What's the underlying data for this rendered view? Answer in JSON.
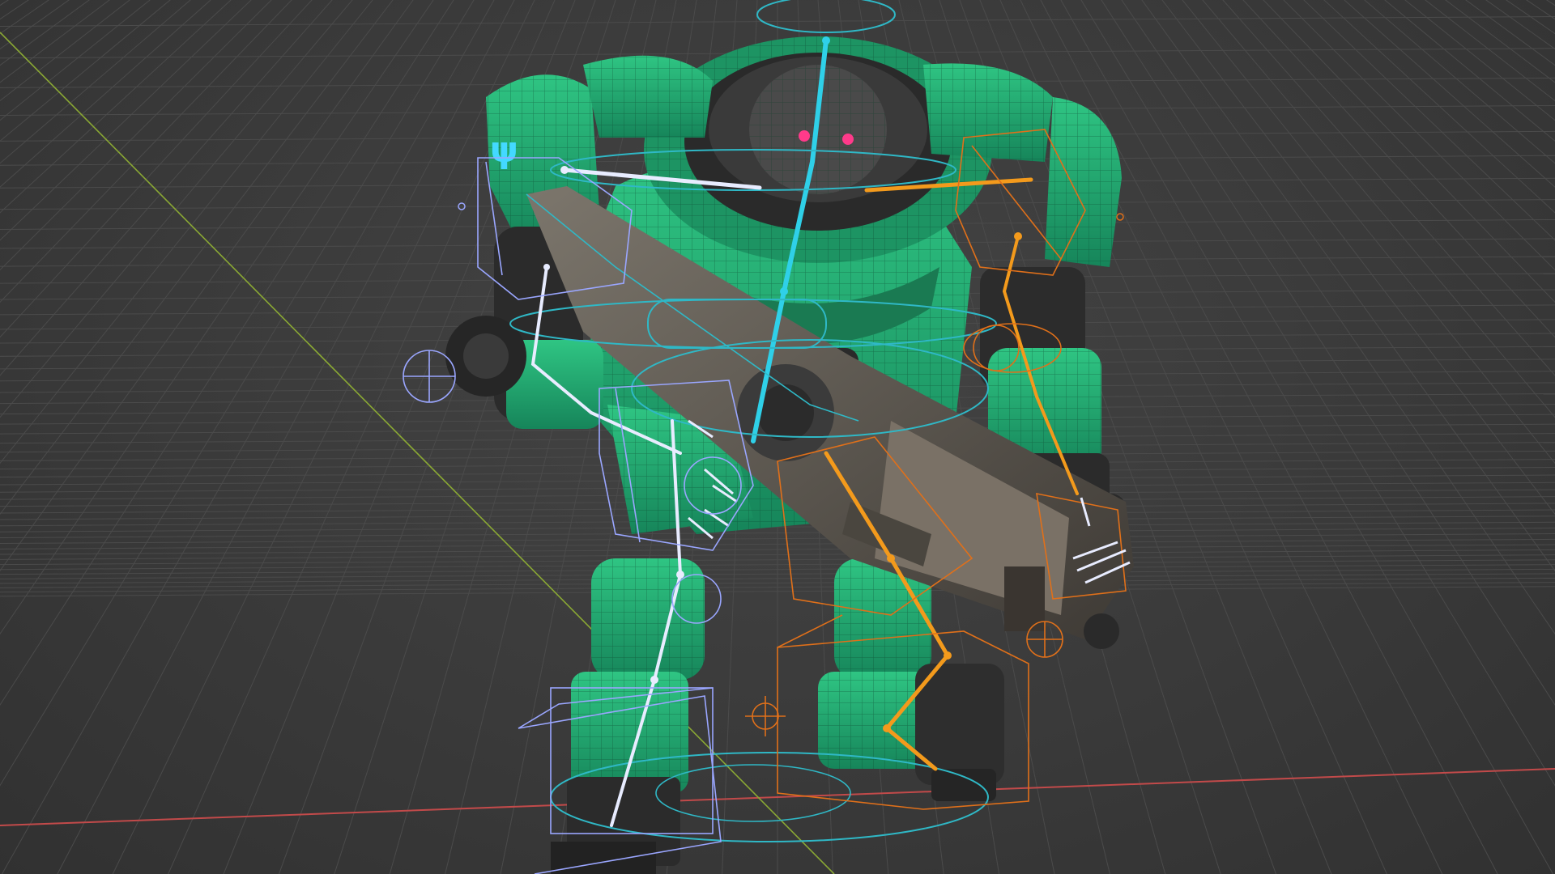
{
  "viewport": {
    "label": "3D viewport",
    "background_color": "#3a3a3a",
    "grid_color": "#4a4a4a",
    "x_axis_color": "#c24a4a",
    "y_axis_color": "#8aa834"
  },
  "model": {
    "name": "green-mech-robot",
    "body_color": "#1fa06a",
    "body_highlight": "#2fc583",
    "dark_parts_color": "#2d2d2d",
    "weapon_color": "#5e5850",
    "eye_color": "#ff3a8a",
    "emblem_color": "#43d9ff"
  },
  "rig": {
    "main_bone_color": "#2fd0e8",
    "left_side_color": "#e8ecff",
    "right_side_color": "#f39a1c",
    "left_control_color": "#9aa6ff",
    "right_control_color": "#e0701a",
    "root_control_color": "#2fb8c6"
  }
}
